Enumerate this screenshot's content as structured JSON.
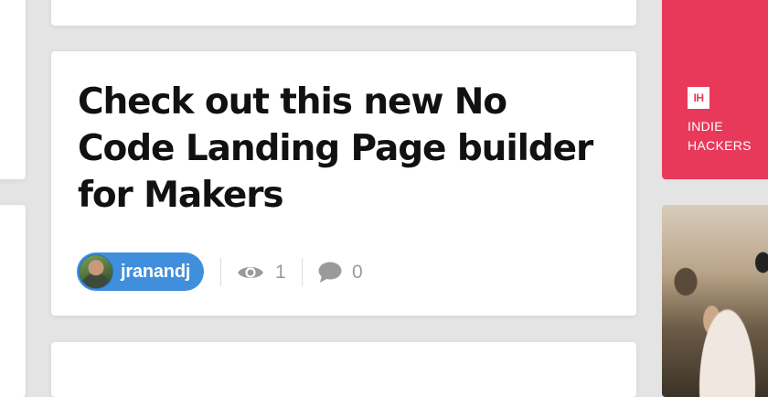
{
  "post": {
    "title": "Check out this new No Code Landing Page builder for Makers",
    "author": {
      "username": "jranandj",
      "avatar_icon": "avatar-icon"
    },
    "stats": {
      "views": "1",
      "comments": "0"
    }
  },
  "sidebar": {
    "ad": {
      "logo_text": "IH",
      "line1": "INDIE",
      "line2": "HACKERS",
      "background": "#e8395a"
    }
  },
  "colors": {
    "author_pill": "#3f8fdc",
    "page_background": "#e4e4e4",
    "stat_gray": "#9a9a9a"
  }
}
